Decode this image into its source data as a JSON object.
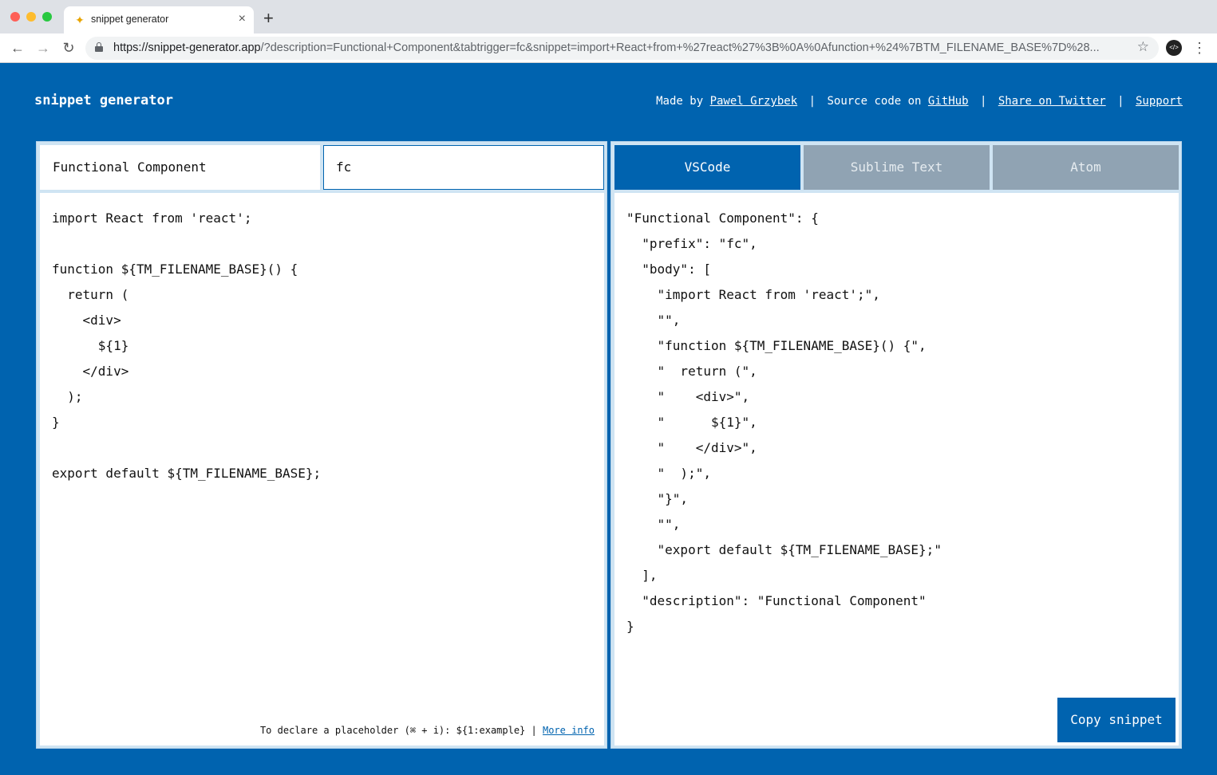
{
  "browser": {
    "tab_title": "snippet generator",
    "new_tab": "+",
    "close": "×",
    "url_host": "https://snippet-generator.app",
    "url_rest": "/?description=Functional+Component&tabtrigger=fc&snippet=import+React+from+%27react%27%3B%0A%0Afunction+%24%7BTM_FILENAME_BASE%7D%28..."
  },
  "header": {
    "brand": "snippet generator",
    "made_by": "Made by",
    "author": "Pawel Grzybek",
    "source_text": "Source code on",
    "github": "GitHub",
    "share": "Share on Twitter",
    "support": "Support",
    "separator": "|"
  },
  "editor": {
    "description_value": "Functional Component",
    "tabtrigger_value": "fc",
    "snippet_lines": [
      "import React from 'react';",
      "",
      "function ${TM_FILENAME_BASE}() {",
      "  return (",
      "    <div>",
      "      ${1}",
      "    </div>",
      "  );",
      "}",
      "",
      "export default ${TM_FILENAME_BASE};"
    ],
    "hint_text": "To declare a placeholder (⌘ + i): ${1:example} |",
    "hint_link": "More info"
  },
  "output": {
    "tabs": [
      {
        "label": "VSCode",
        "active": true
      },
      {
        "label": "Sublime Text",
        "active": false
      },
      {
        "label": "Atom",
        "active": false
      }
    ],
    "lines": [
      "\"Functional Component\": {",
      "  \"prefix\": \"fc\",",
      "  \"body\": [",
      "    \"import React from 'react';\",",
      "    \"\",",
      "    \"function ${TM_FILENAME_BASE}() {\",",
      "    \"  return (\",",
      "    \"    <div>\",",
      "    \"      ${1}\",",
      "    \"    </div>\",",
      "    \"  );\",",
      "    \"}\",",
      "    \"\",",
      "    \"export default ${TM_FILENAME_BASE};\"",
      "  ],",
      "  \"description\": \"Functional Component\"",
      "}"
    ],
    "copy_label": "Copy snippet"
  },
  "colors": {
    "brand_blue": "#0063af",
    "inactive_tab": "#90a3b3",
    "panel_bg": "#cfe4f3"
  }
}
